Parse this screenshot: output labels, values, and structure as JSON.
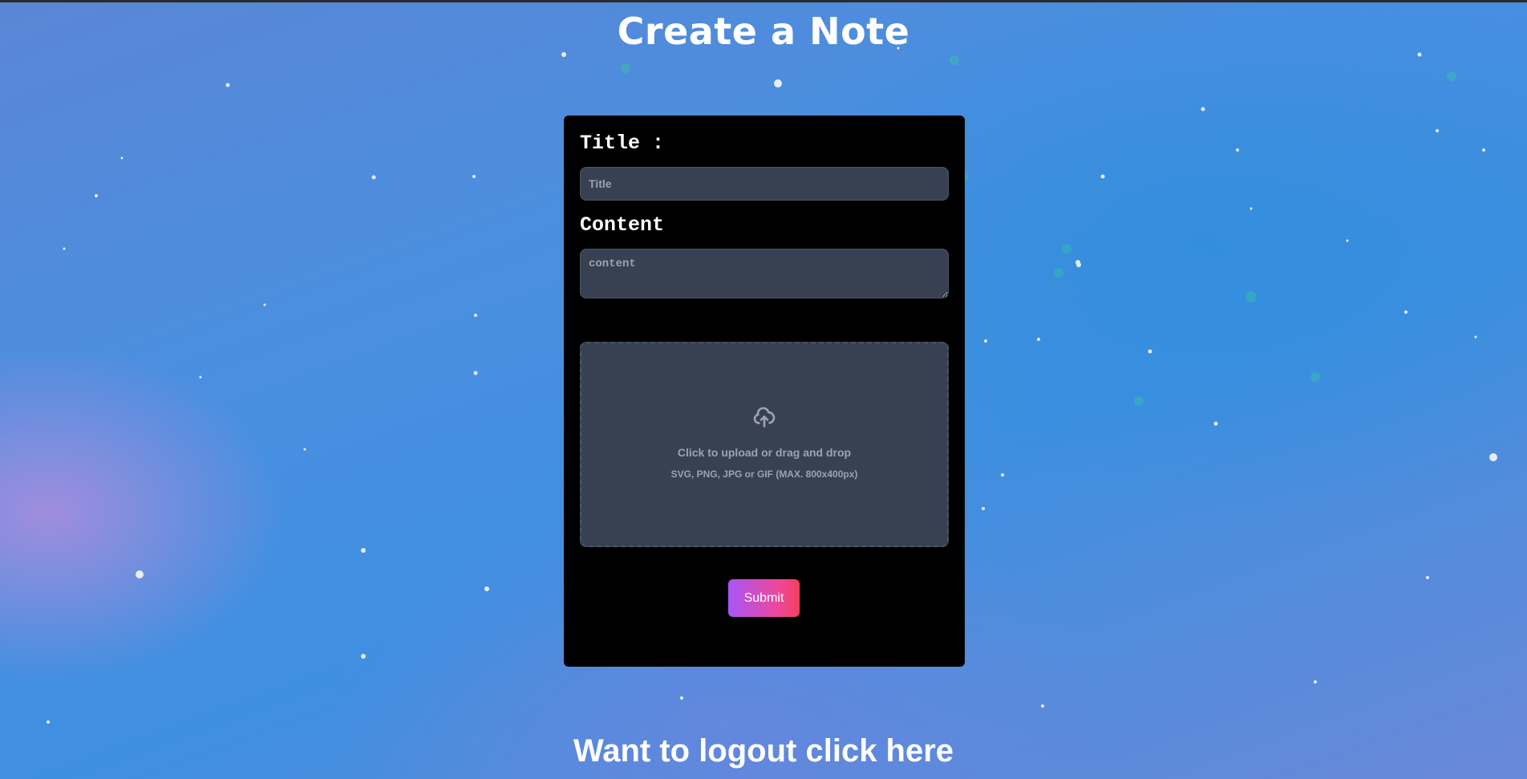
{
  "page": {
    "title": "Create a Note",
    "logout_text": "Want to logout click here"
  },
  "form": {
    "title_label": "Title :",
    "title_placeholder": "Title",
    "title_value": "",
    "content_label": "Content",
    "content_placeholder": "content",
    "content_value": "",
    "upload": {
      "icon": "cloud-upload-icon",
      "main_text": "Click to upload or drag and drop",
      "sub_text": "SVG, PNG, JPG or GIF (MAX. 800x400px)"
    },
    "submit_label": "Submit"
  },
  "colors": {
    "card_bg": "#000000",
    "input_bg": "#374151",
    "input_border": "#4b5563",
    "muted_text": "#9ca3af",
    "submit_gradient_start": "#a855f7",
    "submit_gradient_end": "#ec4899"
  }
}
